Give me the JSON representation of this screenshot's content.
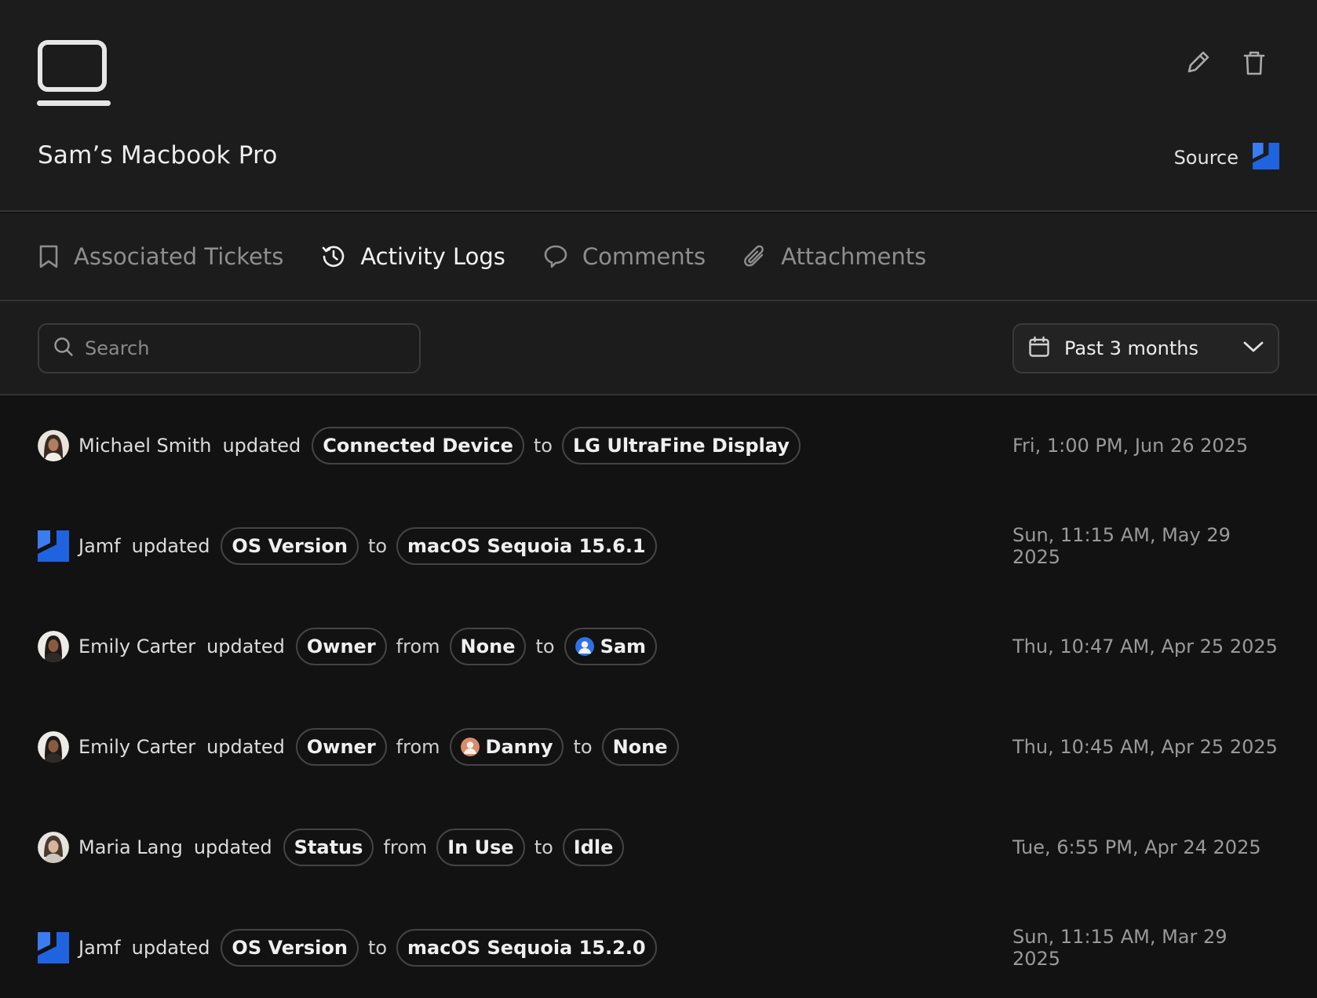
{
  "header": {
    "title": "Sam’s Macbook Pro",
    "device_icon": "laptop-icon",
    "actions": [
      {
        "name": "edit",
        "icon": "pencil-icon"
      },
      {
        "name": "delete",
        "icon": "trash-icon"
      }
    ],
    "source_label": "Source",
    "source_icon": "jamf-logo"
  },
  "tabs": [
    {
      "label": "Associated Tickets",
      "icon": "bookmark-icon",
      "active": false
    },
    {
      "label": "Activity Logs",
      "icon": "history-icon",
      "active": true
    },
    {
      "label": "Comments",
      "icon": "comment-icon",
      "active": false
    },
    {
      "label": "Attachments",
      "icon": "paperclip-icon",
      "active": false
    }
  ],
  "filters": {
    "search_placeholder": "Search",
    "date_range": "Past 3 months"
  },
  "logs": [
    {
      "actor": "Michael Smith",
      "verb": "updated",
      "field": "Connected Device",
      "from_word": "",
      "from_value": "",
      "to_word": "to",
      "to_value": "LG UltraFine Display",
      "time": "Fri, 1:00 PM, Jun 26 2025"
    },
    {
      "actor": "Jamf",
      "verb": "updated",
      "field": "OS Version",
      "from_word": "",
      "from_value": "",
      "to_word": "to",
      "to_value": "macOS Sequoia 15.6.1",
      "time": "Sun, 11:15 AM, May 29 2025"
    },
    {
      "actor": "Emily Carter",
      "verb": "updated",
      "field": "Owner",
      "from_word": "from",
      "from_value": "None",
      "to_word": "to",
      "to_value": "Sam",
      "time": "Thu, 10:47 AM, Apr 25 2025"
    },
    {
      "actor": "Emily Carter",
      "verb": "updated",
      "field": "Owner",
      "from_word": "from",
      "from_value": "Danny",
      "to_word": "to",
      "to_value": "None",
      "time": "Thu, 10:45 AM, Apr 25 2025"
    },
    {
      "actor": "Maria Lang",
      "verb": "updated",
      "field": "Status",
      "from_word": "from",
      "from_value": "In Use",
      "to_word": "to",
      "to_value": "Idle",
      "time": "Tue, 6:55 PM, Apr 24 2025"
    },
    {
      "actor": "Jamf",
      "verb": "updated",
      "field": "OS Version",
      "from_word": "",
      "from_value": "",
      "to_word": "to",
      "to_value": "macOS Sequoia 15.2.0",
      "time": "Sun, 11:15 AM, Mar 29 2025"
    }
  ],
  "colors": {
    "background": "#121212",
    "panel": "#1c1c1c",
    "jamf_blue": "#1f63e0",
    "border": "#333333"
  }
}
